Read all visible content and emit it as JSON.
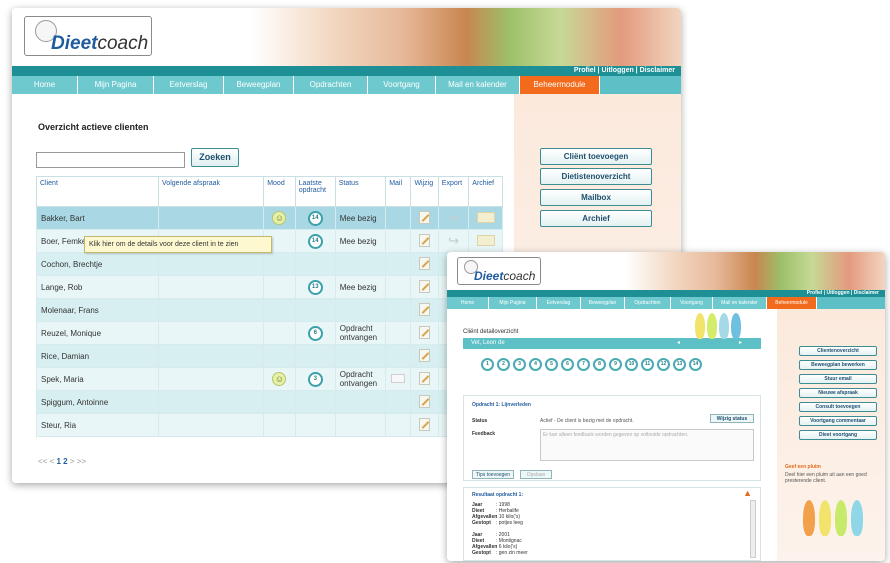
{
  "app": {
    "logo_d": "Dieet",
    "logo_c": "coach"
  },
  "toplinks": "Profiel | Uitloggen | Disclaimer",
  "nav": [
    "Home",
    "Mijn Pagina",
    "Eetverslag",
    "Beweegplan",
    "Opdrachten",
    "Voortgang",
    "Mail en kalender",
    "Beheermodule"
  ],
  "window1": {
    "title": "Overzicht actieve clienten",
    "search_button": "Zoeken",
    "columns": [
      "Client",
      "Volgende afspraak",
      "Mood",
      "Laatste opdracht",
      "Status",
      "Mail",
      "Wijzig",
      "Export",
      "Archief"
    ],
    "rows": [
      {
        "name": "Bakker, Bart",
        "mood": "☺",
        "op": "14",
        "status": "Mee bezig",
        "mail": false
      },
      {
        "name": "Boer, Femke",
        "mood": "",
        "op": "14",
        "status": "Mee bezig",
        "mail": false
      },
      {
        "name": "Cochon, Brechtje",
        "mood": "",
        "op": "",
        "status": "",
        "mail": false
      },
      {
        "name": "Lange, Rob",
        "mood": "",
        "op": "13",
        "status": "Mee bezig",
        "mail": false
      },
      {
        "name": "Molenaar, Frans",
        "mood": "",
        "op": "",
        "status": "",
        "mail": false
      },
      {
        "name": "Reuzel, Monique",
        "mood": "",
        "op": "6",
        "status": "Opdracht ontvangen",
        "mail": false
      },
      {
        "name": "Rice, Damian",
        "mood": "",
        "op": "",
        "status": "",
        "mail": false
      },
      {
        "name": "Spek, Maria",
        "mood": "☺",
        "op": "3",
        "status": "Opdracht ontvangen",
        "mail": true
      },
      {
        "name": "Spiggum, Antoinne",
        "mood": "",
        "op": "",
        "status": "",
        "mail": false
      },
      {
        "name": "Steur, Ria",
        "mood": "",
        "op": "",
        "status": "",
        "mail": false
      }
    ],
    "tooltip": "Klik hier om de details voor deze client in te zien",
    "pager": {
      "prev": "<< <",
      "p1": "1",
      "p2": "2",
      "next": "> >>"
    },
    "side_buttons": [
      "Cliënt toevoegen",
      "Dietistenoverzicht",
      "Mailbox",
      "Archief"
    ]
  },
  "window2": {
    "title": "Cliënt detailoverzicht",
    "client": "Vet, Leon de",
    "circles": [
      "1",
      "2",
      "3",
      "4",
      "5",
      "6",
      "7",
      "8",
      "9",
      "10",
      "11",
      "12",
      "13",
      "14"
    ],
    "opdracht_title": "Opdracht 1: Lijnverleden",
    "status_label": "Status",
    "status_text": "Actief - De client is bezig met de opdracht.",
    "wijzig_status": "Wijzig status",
    "feedback_label": "Feedback",
    "feedback_placeholder": "Er kan alleen feedback worden gegeven op voltooide opdrachten.",
    "tips_button": "Tips toevoegen",
    "opslaan_button": "Opslaan",
    "result_title": "Resultaat opdracht 1:",
    "result1": [
      [
        "Jaar",
        ": 1998"
      ],
      [
        "Dieet",
        ": Herbalife"
      ],
      [
        "Afgevallen",
        ": 10 kilo('s)"
      ],
      [
        "Gestopt",
        ": potjes leeg"
      ]
    ],
    "result2": [
      [
        "Jaar",
        ": 2001"
      ],
      [
        "Dieet",
        ": Montignac"
      ],
      [
        "Afgevallen",
        ": 6 kilo('s)"
      ],
      [
        "Gestopt",
        ": gen zin meer"
      ]
    ],
    "side_buttons": [
      "Clientenoverzicht",
      "Beweegplan bewerken",
      "Stuur email",
      "Nieuwe afspraak",
      "Consult toevoegen",
      "Voortgang commentaar",
      "Dieet voortgang"
    ],
    "geef_title": "Geef een pluim",
    "geef_text": "Deel hier een pluim uit aan een goed presterende client."
  }
}
